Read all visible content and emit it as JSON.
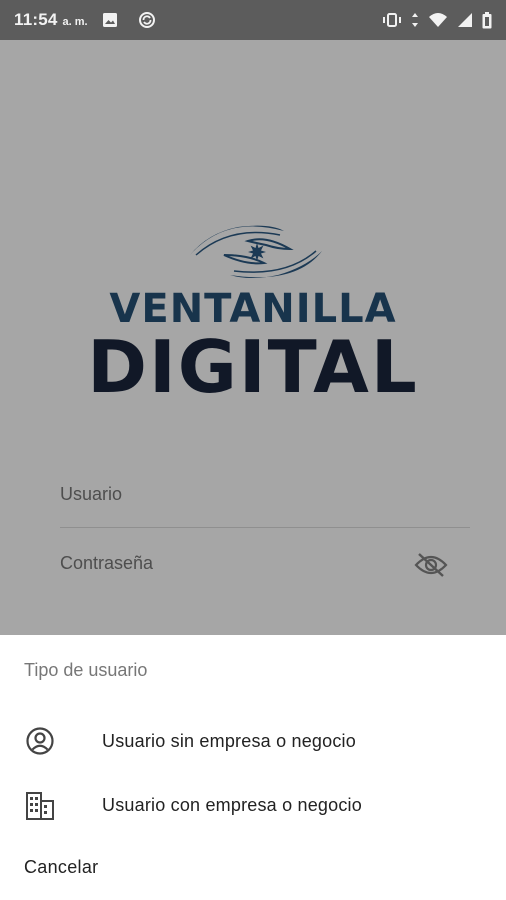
{
  "status_bar": {
    "time": "11:54",
    "ampm": "a. m.",
    "icons": [
      "image-icon",
      "sync-icon",
      "vibrate-icon",
      "data-arrows-icon",
      "wifi-icon",
      "signal-icon",
      "battery-icon"
    ]
  },
  "brand": {
    "line1": "VENTANILLA",
    "line2": "DIGITAL",
    "colors": {
      "line1": "#18344c",
      "line2": "#111827"
    }
  },
  "login": {
    "username_label": "Usuario",
    "password_label": "Contraseña",
    "password_toggle_icon": "eye-off-icon"
  },
  "sheet": {
    "title": "Tipo de usuario",
    "options": [
      {
        "icon": "account-circle-icon",
        "label": "Usuario sin empresa o negocio"
      },
      {
        "icon": "building-icon",
        "label": "Usuario con empresa o negocio"
      }
    ],
    "cancel_label": "Cancelar"
  },
  "colors": {
    "status_bar": "#5c5c5c",
    "scrim_background": "#a6a6a6",
    "sheet_background": "#ffffff"
  }
}
